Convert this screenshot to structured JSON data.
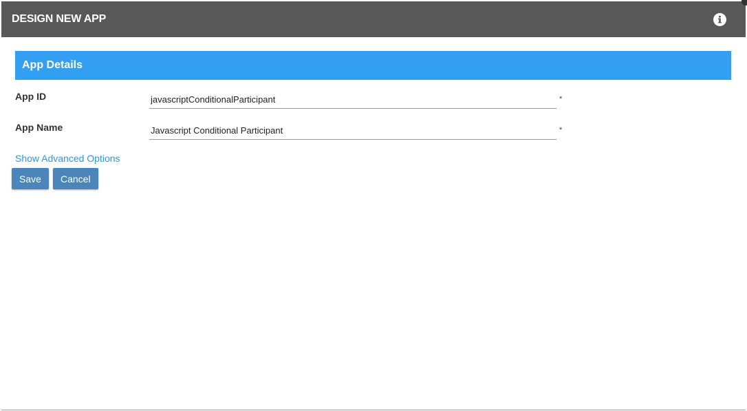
{
  "header": {
    "title": "DESIGN NEW APP",
    "info_icon": "info-circle-icon"
  },
  "section": {
    "title": "App Details"
  },
  "fields": {
    "app_id": {
      "label": "App ID",
      "value": "javascriptConditionalParticipant",
      "required_mark": "*"
    },
    "app_name": {
      "label": "App Name",
      "value": "Javascript Conditional Participant",
      "required_mark": "*"
    }
  },
  "advanced_link": "Show Advanced Options",
  "buttons": {
    "save": "Save",
    "cancel": "Cancel"
  },
  "colors": {
    "header_bg": "#585858",
    "section_bg": "#339ff2",
    "button_bg": "#4a86ba",
    "link": "#2c96e6"
  }
}
